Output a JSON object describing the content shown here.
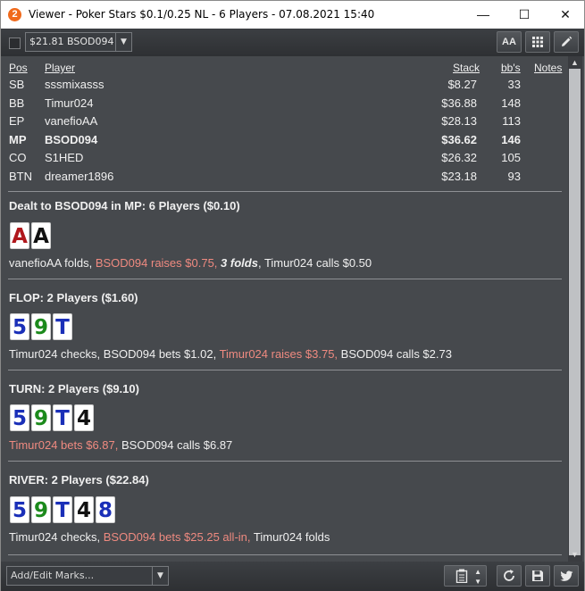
{
  "window": {
    "app_icon_glyph": "2",
    "title": "Viewer - Poker Stars $0.1/0.25 NL - 6 Players - 07.08.2021 15:40",
    "min_glyph": "—",
    "max_glyph": "☐",
    "close_glyph": "✕"
  },
  "toolbar": {
    "hand_select_value": "$21.81 BSOD094",
    "font_button_label": "AA",
    "grid_icon": "grid-icon",
    "edit_icon": "pencil-icon"
  },
  "players_table": {
    "headers": {
      "pos": "Pos",
      "player": "Player",
      "stack": "Stack",
      "bbs": "bb's",
      "notes": "Notes"
    },
    "rows": [
      {
        "pos": "SB",
        "player": "sssmixasss",
        "stack": "$8.27",
        "bbs": "33",
        "hero": false
      },
      {
        "pos": "BB",
        "player": "Timur024",
        "stack": "$36.88",
        "bbs": "148",
        "hero": false
      },
      {
        "pos": "EP",
        "player": "vanefioAA",
        "stack": "$28.13",
        "bbs": "113",
        "hero": false
      },
      {
        "pos": "MP",
        "player": "BSOD094",
        "stack": "$36.62",
        "bbs": "146",
        "hero": true
      },
      {
        "pos": "CO",
        "player": "S1HED",
        "stack": "$26.32",
        "bbs": "105",
        "hero": false
      },
      {
        "pos": "BTN",
        "player": "dreamer1896",
        "stack": "$23.18",
        "bbs": "93",
        "hero": false
      }
    ]
  },
  "preflop": {
    "heading": "Dealt to BSOD094 in MP: 6 Players ($0.10)",
    "cards": [
      {
        "rank": "A",
        "suit": "h"
      },
      {
        "rank": "A",
        "suit": "s"
      }
    ],
    "actions": [
      {
        "text": "vanefioAA folds, ",
        "style": "normal"
      },
      {
        "text": "BSOD094 raises $0.75, ",
        "style": "hl"
      },
      {
        "text": "3 folds",
        "style": "ital"
      },
      {
        "text": ", Timur024 calls $0.50",
        "style": "normal"
      }
    ]
  },
  "flop": {
    "heading": "FLOP: 2 Players ($1.60)",
    "cards": [
      {
        "rank": "5",
        "suit": "d"
      },
      {
        "rank": "9",
        "suit": "c"
      },
      {
        "rank": "T",
        "suit": "d"
      }
    ],
    "actions": [
      {
        "text": "Timur024 checks, BSOD094 bets $1.02, ",
        "style": "normal"
      },
      {
        "text": "Timur024 raises $3.75, ",
        "style": "hl"
      },
      {
        "text": "BSOD094 calls $2.73",
        "style": "normal"
      }
    ]
  },
  "turn": {
    "heading": "TURN: 2 Players ($9.10)",
    "cards": [
      {
        "rank": "5",
        "suit": "d"
      },
      {
        "rank": "9",
        "suit": "c"
      },
      {
        "rank": "T",
        "suit": "d"
      },
      {
        "rank": "4",
        "suit": "s"
      }
    ],
    "actions": [
      {
        "text": "Timur024 bets $6.87, ",
        "style": "hl"
      },
      {
        "text": "BSOD094 calls $6.87",
        "style": "normal"
      }
    ]
  },
  "river": {
    "heading": "RIVER: 2 Players ($22.84)",
    "cards": [
      {
        "rank": "5",
        "suit": "d"
      },
      {
        "rank": "9",
        "suit": "c"
      },
      {
        "rank": "T",
        "suit": "d"
      },
      {
        "rank": "4",
        "suit": "s"
      },
      {
        "rank": "8",
        "suit": "d"
      }
    ],
    "actions": [
      {
        "text": "Timur024 checks, ",
        "style": "normal"
      },
      {
        "text": "BSOD094 bets $25.25 all-in, ",
        "style": "hl"
      },
      {
        "text": "Timur024 folds",
        "style": "normal"
      }
    ]
  },
  "bottombar": {
    "marks_placeholder": "Add/Edit Marks...",
    "clipboard_icon": "clipboard-icon",
    "refresh_icon": "refresh-icon",
    "save_icon": "save-icon",
    "twitter_icon": "twitter-icon"
  },
  "colors": {
    "highlight": "#ef8a80",
    "heart": "#b0171c",
    "club": "#1c8a1c",
    "diamond": "#1a2fb8",
    "spade": "#111111"
  }
}
